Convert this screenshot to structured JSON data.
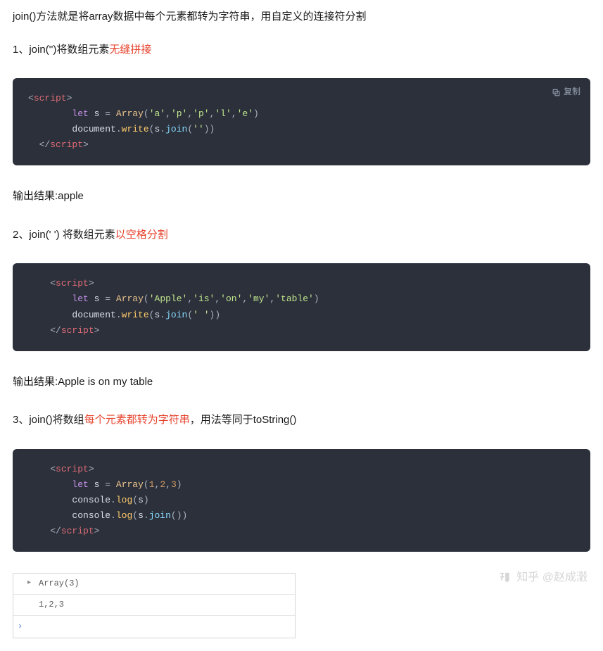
{
  "intro": "join()方法就是将array数据中每个元素都转为字符串，用自定义的连接符分割",
  "section1": {
    "prefix": "1、join('')将数组元素",
    "highlight": "无缝拼接",
    "result": "输出结果:apple"
  },
  "section2": {
    "prefix": "2、join(' ') 将数组元素",
    "highlight": "以空格分割",
    "result": "输出结果:Apple is on my table"
  },
  "section3": {
    "prefix": "3、join()将数组",
    "highlight": "每个元素都转为字符串",
    "suffix": "，用法等同于toString()"
  },
  "copy_label": "复制",
  "code1": {
    "open": "script",
    "let": "let",
    "varname": "s",
    "eq": "=",
    "array": "Array",
    "args": [
      "'a'",
      "'p'",
      "'p'",
      "'l'",
      "'e'"
    ],
    "doc": "document",
    "write": "write",
    "join": "join",
    "joinarg": "''",
    "close": "script"
  },
  "code2": {
    "open": "script",
    "let": "let",
    "varname": "s",
    "eq": "=",
    "array": "Array",
    "args": [
      "'Apple'",
      "'is'",
      "'on'",
      "'my'",
      "'table'"
    ],
    "doc": "document",
    "write": "write",
    "join": "join",
    "joinarg": "' '",
    "close": "script"
  },
  "code3": {
    "open": "script",
    "let": "let",
    "varname": "s",
    "eq": "=",
    "array": "Array",
    "args_num": [
      "1",
      "2",
      "3"
    ],
    "console": "console",
    "log": "log",
    "join": "join",
    "close": "script"
  },
  "console_out": {
    "line1": "Array(3)",
    "line2": "1,2,3"
  },
  "watermark": "知乎 @赵成瀔"
}
